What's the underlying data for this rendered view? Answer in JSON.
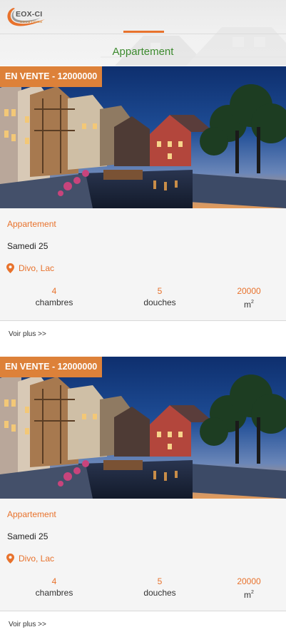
{
  "app": {
    "logo_text": "EOX-CI",
    "logo_sub": "SOLUTIONS",
    "page_title": "Appartement"
  },
  "colors": {
    "accent": "#e8722c",
    "badge": "#dd8139",
    "title_green": "#3c8a2e"
  },
  "listings": [
    {
      "badge": "EN VENTE - 12000000",
      "type": "Appartement",
      "date": "Samedi 25",
      "location": "Divo, Lac",
      "location_icon": "map-pin-icon",
      "bedrooms": {
        "value": "4",
        "label": "chambres"
      },
      "showers": {
        "value": "5",
        "label": "douches"
      },
      "area": {
        "value": "20000",
        "unit": "m",
        "exp": "2"
      },
      "more_link": "Voir plus >>"
    },
    {
      "badge": "EN VENTE - 12000000",
      "type": "Appartement",
      "date": "Samedi 25",
      "location": "Divo, Lac",
      "location_icon": "map-pin-icon",
      "bedrooms": {
        "value": "4",
        "label": "chambres"
      },
      "showers": {
        "value": "5",
        "label": "douches"
      },
      "area": {
        "value": "20000",
        "unit": "m",
        "exp": "2"
      },
      "more_link": "Voir plus >>"
    }
  ]
}
